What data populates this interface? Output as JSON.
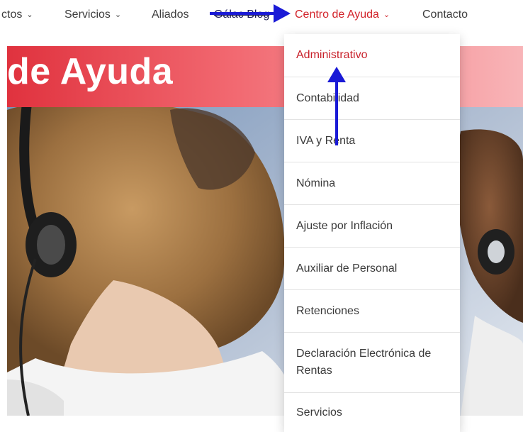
{
  "nav": {
    "items": [
      {
        "label": "ctos",
        "chevron": "⌄"
      },
      {
        "label": "Servicios",
        "chevron": "⌄"
      },
      {
        "label": "Aliados"
      },
      {
        "label": "Gálac Blog"
      },
      {
        "label": "Centro de Ayuda",
        "chevron": "⌄"
      },
      {
        "label": "Contacto"
      }
    ]
  },
  "hero": {
    "title": "de Ayuda"
  },
  "dropdown": {
    "items": [
      {
        "label": "Administrativo"
      },
      {
        "label": "Contabilidad"
      },
      {
        "label": "IVA y Renta"
      },
      {
        "label": "Nómina"
      },
      {
        "label": "Ajuste por Inflación"
      },
      {
        "label": "Auxiliar de Personal"
      },
      {
        "label": "Retenciones"
      },
      {
        "label": "Declaración Electrónica de Rentas"
      },
      {
        "label": "Servicios"
      }
    ]
  },
  "colors": {
    "accent": "#d2232a",
    "active_menu": "#c8202a",
    "annotation_arrow": "#1a1ad6",
    "hero_gradient_start": "#e0323e",
    "hero_gradient_end": "#f8b5b8"
  },
  "icons": {
    "dropdown_indicator": "chevron-down-icon",
    "annotation": "arrow-icon"
  }
}
